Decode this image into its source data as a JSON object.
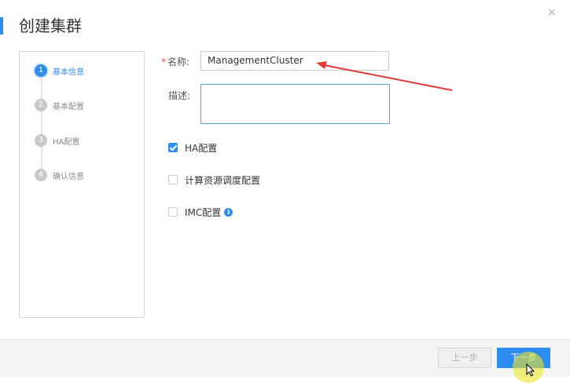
{
  "dialog": {
    "title": "创建集群",
    "close_symbol": "×"
  },
  "steps": [
    {
      "num": "1",
      "label": "基本信息",
      "active": true
    },
    {
      "num": "2",
      "label": "基本配置",
      "active": false
    },
    {
      "num": "3",
      "label": "HA配置",
      "active": false
    },
    {
      "num": "4",
      "label": "确认信息",
      "active": false
    }
  ],
  "form": {
    "name_required_mark": "*",
    "name_label": "名称:",
    "name_value": "ManagementCluster",
    "desc_label": "描述:",
    "desc_value": ""
  },
  "options": [
    {
      "label": "HA配置",
      "checked": true
    },
    {
      "label": "计算资源调度配置",
      "checked": false
    },
    {
      "label": "IMC配置",
      "checked": false,
      "info_icon": "i"
    }
  ],
  "footer": {
    "prev_label": "上一步",
    "next_label": "下一步"
  },
  "colors": {
    "accent": "#2d8cf0",
    "annotation_arrow": "#e53935",
    "cursor_highlight": "#ebe628"
  },
  "icons": [
    "close-icon",
    "info-icon",
    "check-icon",
    "mouse-cursor-icon",
    "annotation-arrow"
  ]
}
